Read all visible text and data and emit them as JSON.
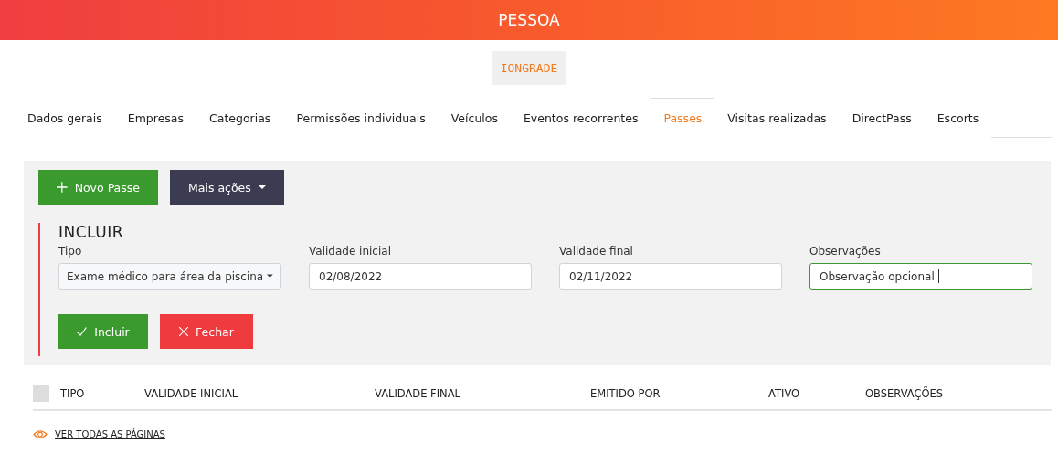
{
  "header": {
    "title": "PESSOA"
  },
  "badge": "IONGRADE",
  "tabs": [
    {
      "label": "Dados gerais",
      "selected": false
    },
    {
      "label": "Empresas",
      "selected": false
    },
    {
      "label": "Categorias",
      "selected": false
    },
    {
      "label": "Permissões individuais",
      "selected": false
    },
    {
      "label": "Veículos",
      "selected": false
    },
    {
      "label": "Eventos recorrentes",
      "selected": false
    },
    {
      "label": "Passes",
      "selected": true
    },
    {
      "label": "Visitas realizadas",
      "selected": false
    },
    {
      "label": "DirectPass",
      "selected": false
    },
    {
      "label": "Escorts",
      "selected": false
    }
  ],
  "toolbar": {
    "new_button": "Novo Passe",
    "more_button": "Mais ações"
  },
  "form": {
    "title": "INCLUIR",
    "fields": [
      {
        "kind": "select",
        "label": "Tipo",
        "value": "Exame médico para área da piscina",
        "focused": false
      },
      {
        "kind": "input",
        "label": "Validade inicial",
        "value": "02/08/2022",
        "focused": false
      },
      {
        "kind": "input",
        "label": "Validade final",
        "value": "02/11/2022",
        "focused": false
      },
      {
        "kind": "input",
        "label": "Observações",
        "value": "Observação opcional",
        "focused": true
      }
    ],
    "submit_button": "Incluir",
    "close_button": "Fechar"
  },
  "table": {
    "columns": [
      "TIPO",
      "VALIDADE INICIAL",
      "VALIDADE FINAL",
      "EMITIDO POR",
      "ATIVO",
      "OBSERVAÇÕES"
    ],
    "select_all_checked": false
  },
  "footer_link": "VER TODAS AS PÁGINAS"
}
